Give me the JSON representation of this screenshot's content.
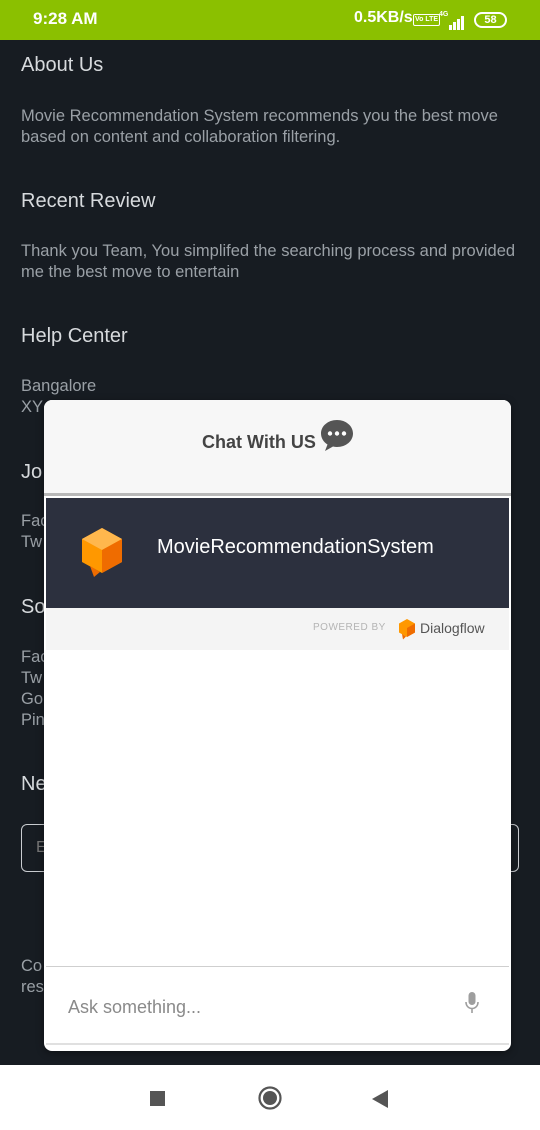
{
  "status_bar": {
    "time": "9:28 AM",
    "speed": "0.5KB/s",
    "volte": "Vo LTE",
    "network": "4G",
    "battery": "58"
  },
  "page": {
    "about": {
      "heading": "About Us",
      "text": "Movie Recommendation System recommends you the best move based on content and collaboration filtering."
    },
    "review": {
      "heading": "Recent Review",
      "text": "Thank you Team, You simplifed the searching process and provided me the best move to entertain"
    },
    "help": {
      "heading": "Help Center",
      "line1": "Bangalore",
      "line2": "XY"
    },
    "join": {
      "heading_frag": "Jo",
      "line1": "Fac",
      "line2": "Tw"
    },
    "social": {
      "heading_frag": "So",
      "line1": "Fac",
      "line2": "Tw",
      "line3": "Go",
      "line4": "Pin"
    },
    "newsletter": {
      "heading_frag": "Ne",
      "input_frag": "E"
    },
    "footer": {
      "line1": "Co",
      "line2": "res"
    }
  },
  "chat": {
    "title": "Chat With US",
    "agent_name": "MovieRecommendationSystem",
    "powered_by": "POWERED BY",
    "brand": "Dialogflow",
    "input_placeholder": "Ask something..."
  },
  "colors": {
    "status_bar": "#8bc000",
    "page_bg": "#171c22",
    "agent_bar": "#2c303e",
    "dialogflow_orange": "#ef6c00"
  },
  "icons": {
    "chat_bubble": "speech-bubble-dots-icon",
    "agent_logo": "dialogflow-cube-icon",
    "mic": "microphone-icon",
    "nav_recent": "square-icon",
    "nav_home": "circle-icon",
    "nav_back": "triangle-back-icon"
  }
}
